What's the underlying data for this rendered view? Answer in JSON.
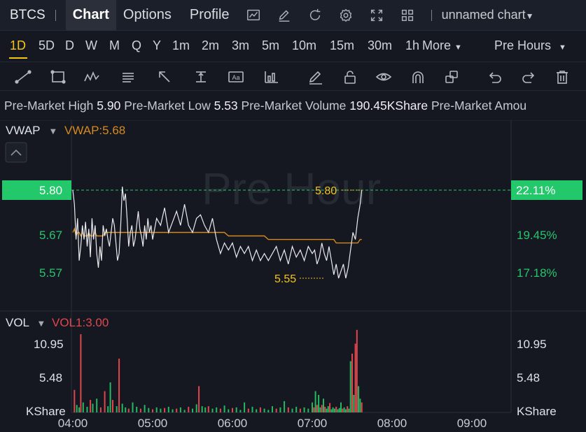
{
  "topbar": {
    "ticker": "BTCS",
    "tabs": [
      "Chart",
      "Options",
      "Profile"
    ],
    "icons": [
      "chart-icon",
      "edit-icon",
      "refresh-icon",
      "settings-icon",
      "fullscreen-icon",
      "grid-icon"
    ],
    "chart_name": "unnamed chart"
  },
  "intervals": {
    "items": [
      "1D",
      "5D",
      "D",
      "W",
      "M",
      "Q",
      "Y",
      "1m",
      "2m",
      "3m",
      "5m",
      "10m",
      "15m",
      "30m",
      "1h"
    ],
    "selected": "1D",
    "more_label": "More",
    "session_label": "Pre Hours"
  },
  "drawing_tools": [
    "trendline-icon",
    "rectangle-icon",
    "wave-icon",
    "text-icon",
    "arrow-icon",
    "anchor-icon",
    "label-icon",
    "bars-icon",
    "pen-icon",
    "lock-icon",
    "eye-icon",
    "magnet-icon",
    "layers-icon",
    "undo-icon",
    "redo-icon",
    "trash-icon"
  ],
  "premarket": {
    "high_label": "Pre-Market High",
    "high": "5.90",
    "low_label": "Pre-Market Low",
    "low": "5.53",
    "volume_label": "Pre-Market Volume",
    "volume": "190.45KShare",
    "amount_label": "Pre-Market Amou"
  },
  "price_pane": {
    "indicator": "VWAP",
    "indicator_value": "VWAP:5.68",
    "watermark": "Pre Hour",
    "current_price": "5.80",
    "current_pct": "22.11%",
    "high_marker": "5.80",
    "low_marker": "5.55",
    "left_ticks": [
      "5.67",
      "5.57"
    ],
    "right_ticks": [
      "19.45%",
      "17.18%"
    ]
  },
  "volume_pane": {
    "indicator": "VOL",
    "indicator_value": "VOL1:3.00",
    "left_ticks": [
      "10.95",
      "5.48",
      "KShare"
    ],
    "right_ticks": [
      "10.95",
      "5.48",
      "KShare"
    ]
  },
  "time_axis": [
    "04:00",
    "05:00",
    "06:00",
    "07:00",
    "08:00",
    "09:00"
  ],
  "colors": {
    "up": "#26b861",
    "down": "#e0474c",
    "vwap": "#d58a1f",
    "highlight": "#f5c518",
    "price_tag": "#22c86a"
  },
  "chart_data": {
    "type": "line",
    "price_range": [
      5.52,
      5.86
    ],
    "pct_range": [
      16.6,
      23.5
    ],
    "vol_range": [
      0,
      13.7
    ],
    "time_range_hours": [
      4.0,
      9.5
    ],
    "x_hours": [
      4.0,
      4.02,
      4.04,
      4.06,
      4.08,
      4.1,
      4.12,
      4.14,
      4.16,
      4.18,
      4.2,
      4.22,
      4.24,
      4.26,
      4.28,
      4.3,
      4.32,
      4.34,
      4.36,
      4.38,
      4.4,
      4.42,
      4.44,
      4.46,
      4.48,
      4.5,
      4.52,
      4.54,
      4.56,
      4.58,
      4.6,
      4.62,
      4.64,
      4.66,
      4.68,
      4.7,
      4.72,
      4.74,
      4.76,
      4.78,
      4.8,
      4.82,
      4.84,
      4.86,
      4.88,
      4.9,
      4.92,
      4.94,
      4.96,
      4.98,
      5.0,
      5.05,
      5.1,
      5.15,
      5.2,
      5.25,
      5.3,
      5.35,
      5.4,
      5.45,
      5.5,
      5.55,
      5.6,
      5.65,
      5.7,
      5.75,
      5.8,
      5.85,
      5.9,
      5.95,
      6.0,
      6.05,
      6.1,
      6.15,
      6.2,
      6.25,
      6.3,
      6.35,
      6.4,
      6.45,
      6.5,
      6.55,
      6.6,
      6.65,
      6.7,
      6.75,
      6.8,
      6.85,
      6.9,
      6.95,
      7.0,
      7.03,
      7.06,
      7.09,
      7.12,
      7.15,
      7.18,
      7.21,
      7.24,
      7.27,
      7.3,
      7.33,
      7.36,
      7.39,
      7.42,
      7.45,
      7.48,
      7.51,
      7.54,
      7.57,
      7.6,
      7.62
    ],
    "price": [
      5.8,
      5.76,
      5.66,
      5.72,
      5.6,
      5.64,
      5.7,
      5.66,
      5.71,
      5.64,
      5.69,
      5.61,
      5.72,
      5.66,
      5.7,
      5.62,
      5.58,
      5.64,
      5.6,
      5.7,
      5.67,
      5.69,
      5.66,
      5.64,
      5.68,
      5.72,
      5.7,
      5.65,
      5.6,
      5.62,
      5.7,
      5.81,
      5.77,
      5.79,
      5.72,
      5.64,
      5.68,
      5.7,
      5.64,
      5.66,
      5.7,
      5.74,
      5.69,
      5.67,
      5.64,
      5.7,
      5.66,
      5.72,
      5.68,
      5.7,
      5.66,
      5.72,
      5.7,
      5.75,
      5.68,
      5.71,
      5.74,
      5.7,
      5.76,
      5.7,
      5.68,
      5.72,
      5.73,
      5.7,
      5.68,
      5.72,
      5.66,
      5.62,
      5.65,
      5.63,
      5.65,
      5.61,
      5.64,
      5.62,
      5.64,
      5.6,
      5.63,
      5.6,
      5.62,
      5.6,
      5.62,
      5.64,
      5.6,
      5.63,
      5.59,
      5.64,
      5.61,
      5.63,
      5.6,
      5.64,
      5.62,
      5.63,
      5.59,
      5.61,
      5.65,
      5.62,
      5.6,
      5.64,
      5.6,
      5.56,
      5.59,
      5.55,
      5.57,
      5.59,
      5.55,
      5.58,
      5.63,
      5.68,
      5.66,
      5.72,
      5.76,
      5.8
    ],
    "vwap": [
      5.68,
      5.69,
      5.67,
      5.68,
      5.68,
      5.67,
      5.68,
      5.67,
      5.67,
      5.67,
      5.68,
      5.67,
      5.67,
      5.67,
      5.68,
      5.67,
      5.67,
      5.67,
      5.67,
      5.67,
      5.68,
      5.68,
      5.68,
      5.68,
      5.68,
      5.68,
      5.68,
      5.68,
      5.68,
      5.68,
      5.68,
      5.68,
      5.68,
      5.68,
      5.68,
      5.68,
      5.68,
      5.68,
      5.68,
      5.68,
      5.68,
      5.68,
      5.68,
      5.68,
      5.68,
      5.68,
      5.68,
      5.68,
      5.68,
      5.68,
      5.68,
      5.68,
      5.68,
      5.68,
      5.68,
      5.68,
      5.68,
      5.68,
      5.68,
      5.68,
      5.68,
      5.68,
      5.68,
      5.68,
      5.68,
      5.68,
      5.68,
      5.68,
      5.68,
      5.67,
      5.67,
      5.67,
      5.67,
      5.67,
      5.67,
      5.67,
      5.67,
      5.67,
      5.67,
      5.66,
      5.66,
      5.66,
      5.66,
      5.66,
      5.66,
      5.66,
      5.66,
      5.66,
      5.66,
      5.66,
      5.66,
      5.66,
      5.66,
      5.66,
      5.66,
      5.66,
      5.66,
      5.66,
      5.66,
      5.66,
      5.65,
      5.65,
      5.65,
      5.65,
      5.65,
      5.65,
      5.65,
      5.65,
      5.65,
      5.65,
      5.66,
      5.66
    ],
    "volumes": [
      {
        "x": 4.02,
        "v": 3.6,
        "up": false
      },
      {
        "x": 4.05,
        "v": 1.2,
        "up": true
      },
      {
        "x": 4.08,
        "v": 0.8,
        "up": true
      },
      {
        "x": 4.1,
        "v": 12.5,
        "up": false
      },
      {
        "x": 4.13,
        "v": 1.6,
        "up": true
      },
      {
        "x": 4.18,
        "v": 0.9,
        "up": true
      },
      {
        "x": 4.22,
        "v": 2.0,
        "up": false
      },
      {
        "x": 4.25,
        "v": 1.4,
        "up": true
      },
      {
        "x": 4.3,
        "v": 2.2,
        "up": true
      },
      {
        "x": 4.35,
        "v": 0.8,
        "up": false
      },
      {
        "x": 4.4,
        "v": 3.4,
        "up": false
      },
      {
        "x": 4.44,
        "v": 1.0,
        "up": true
      },
      {
        "x": 4.47,
        "v": 4.8,
        "up": true
      },
      {
        "x": 4.5,
        "v": 2.0,
        "up": false
      },
      {
        "x": 4.55,
        "v": 1.0,
        "up": true
      },
      {
        "x": 4.58,
        "v": 8.6,
        "up": false
      },
      {
        "x": 4.62,
        "v": 1.4,
        "up": true
      },
      {
        "x": 4.66,
        "v": 0.8,
        "up": true
      },
      {
        "x": 4.7,
        "v": 0.6,
        "up": false
      },
      {
        "x": 4.75,
        "v": 1.6,
        "up": true
      },
      {
        "x": 4.8,
        "v": 0.9,
        "up": true
      },
      {
        "x": 4.85,
        "v": 0.6,
        "up": false
      },
      {
        "x": 4.9,
        "v": 1.2,
        "up": true
      },
      {
        "x": 4.95,
        "v": 0.7,
        "up": true
      },
      {
        "x": 5.0,
        "v": 0.5,
        "up": false
      },
      {
        "x": 5.05,
        "v": 0.8,
        "up": true
      },
      {
        "x": 5.1,
        "v": 0.6,
        "up": true
      },
      {
        "x": 5.15,
        "v": 0.7,
        "up": false
      },
      {
        "x": 5.2,
        "v": 0.9,
        "up": true
      },
      {
        "x": 5.25,
        "v": 0.5,
        "up": true
      },
      {
        "x": 5.3,
        "v": 0.6,
        "up": false
      },
      {
        "x": 5.35,
        "v": 0.8,
        "up": true
      },
      {
        "x": 5.4,
        "v": 0.4,
        "up": true
      },
      {
        "x": 5.45,
        "v": 0.9,
        "up": false
      },
      {
        "x": 5.5,
        "v": 0.6,
        "up": true
      },
      {
        "x": 5.55,
        "v": 1.3,
        "up": true
      },
      {
        "x": 5.58,
        "v": 4.2,
        "up": false
      },
      {
        "x": 5.62,
        "v": 1.0,
        "up": true
      },
      {
        "x": 5.66,
        "v": 0.8,
        "up": true
      },
      {
        "x": 5.7,
        "v": 1.0,
        "up": false
      },
      {
        "x": 5.75,
        "v": 0.6,
        "up": true
      },
      {
        "x": 5.8,
        "v": 0.8,
        "up": true
      },
      {
        "x": 5.85,
        "v": 0.6,
        "up": false
      },
      {
        "x": 5.9,
        "v": 1.1,
        "up": true
      },
      {
        "x": 5.95,
        "v": 0.5,
        "up": true
      },
      {
        "x": 6.0,
        "v": 0.7,
        "up": false
      },
      {
        "x": 6.05,
        "v": 0.8,
        "up": true
      },
      {
        "x": 6.1,
        "v": 0.4,
        "up": true
      },
      {
        "x": 6.15,
        "v": 1.6,
        "up": true
      },
      {
        "x": 6.2,
        "v": 0.6,
        "up": false
      },
      {
        "x": 6.25,
        "v": 0.9,
        "up": true
      },
      {
        "x": 6.3,
        "v": 0.5,
        "up": true
      },
      {
        "x": 6.35,
        "v": 0.8,
        "up": false
      },
      {
        "x": 6.4,
        "v": 0.6,
        "up": true
      },
      {
        "x": 6.45,
        "v": 0.4,
        "up": true
      },
      {
        "x": 6.5,
        "v": 1.0,
        "up": true
      },
      {
        "x": 6.55,
        "v": 0.6,
        "up": false
      },
      {
        "x": 6.6,
        "v": 0.8,
        "up": true
      },
      {
        "x": 6.65,
        "v": 1.8,
        "up": true
      },
      {
        "x": 6.7,
        "v": 0.8,
        "up": false
      },
      {
        "x": 6.75,
        "v": 0.6,
        "up": true
      },
      {
        "x": 6.8,
        "v": 0.9,
        "up": true
      },
      {
        "x": 6.85,
        "v": 0.6,
        "up": false
      },
      {
        "x": 6.9,
        "v": 0.8,
        "up": true
      },
      {
        "x": 6.95,
        "v": 0.6,
        "up": true
      },
      {
        "x": 7.0,
        "v": 1.6,
        "up": true
      },
      {
        "x": 7.02,
        "v": 0.8,
        "up": false
      },
      {
        "x": 7.04,
        "v": 3.4,
        "up": true
      },
      {
        "x": 7.06,
        "v": 1.2,
        "up": false
      },
      {
        "x": 7.08,
        "v": 2.8,
        "up": true
      },
      {
        "x": 7.1,
        "v": 0.8,
        "up": true
      },
      {
        "x": 7.12,
        "v": 1.2,
        "up": false
      },
      {
        "x": 7.14,
        "v": 2.2,
        "up": true
      },
      {
        "x": 7.16,
        "v": 0.9,
        "up": false
      },
      {
        "x": 7.18,
        "v": 0.6,
        "up": true
      },
      {
        "x": 7.2,
        "v": 1.0,
        "up": true
      },
      {
        "x": 7.22,
        "v": 1.5,
        "up": false
      },
      {
        "x": 7.24,
        "v": 0.5,
        "up": true
      },
      {
        "x": 7.26,
        "v": 0.8,
        "up": true
      },
      {
        "x": 7.28,
        "v": 0.6,
        "up": true
      },
      {
        "x": 7.3,
        "v": 0.9,
        "up": false
      },
      {
        "x": 7.32,
        "v": 0.5,
        "up": true
      },
      {
        "x": 7.34,
        "v": 0.7,
        "up": true
      },
      {
        "x": 7.36,
        "v": 1.6,
        "up": true
      },
      {
        "x": 7.38,
        "v": 0.6,
        "up": false
      },
      {
        "x": 7.4,
        "v": 0.8,
        "up": true
      },
      {
        "x": 7.42,
        "v": 0.5,
        "up": true
      },
      {
        "x": 7.44,
        "v": 1.0,
        "up": false
      },
      {
        "x": 7.46,
        "v": 0.6,
        "up": true
      },
      {
        "x": 7.48,
        "v": 8.2,
        "up": true
      },
      {
        "x": 7.5,
        "v": 9.4,
        "up": false
      },
      {
        "x": 7.52,
        "v": 2.8,
        "up": true
      },
      {
        "x": 7.54,
        "v": 11.0,
        "up": false
      },
      {
        "x": 7.56,
        "v": 13.2,
        "up": false
      },
      {
        "x": 7.58,
        "v": 4.2,
        "up": true
      },
      {
        "x": 7.6,
        "v": 2.2,
        "up": true
      },
      {
        "x": 7.62,
        "v": 1.6,
        "up": false
      }
    ]
  }
}
